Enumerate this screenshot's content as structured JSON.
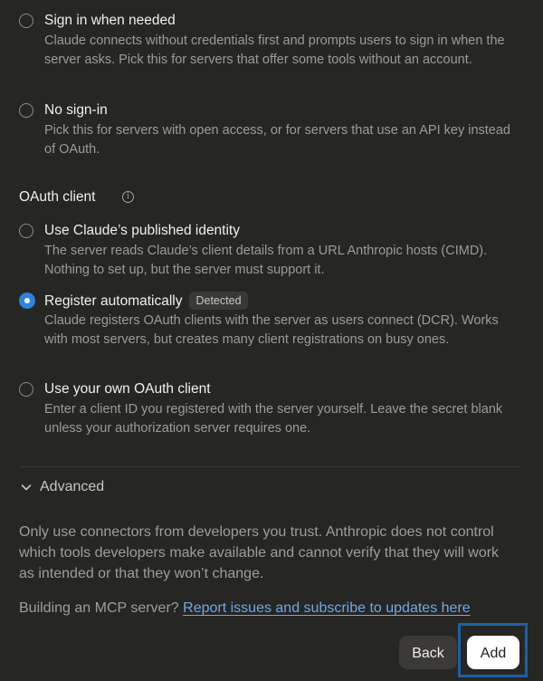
{
  "auth": {
    "options": [
      {
        "title": "Sign in when needed",
        "description": "Claude connects without credentials first and prompts users to sign in when the server asks. Pick this for servers that offer some tools without an account.",
        "selected": false
      },
      {
        "title": "No sign-in",
        "description": "Pick this for servers with open access, or for servers that use an API key instead of OAuth.",
        "selected": false
      }
    ]
  },
  "oauth_client": {
    "title": "OAuth client",
    "info_icon": "info-icon",
    "options": [
      {
        "title": "Use Claude’s published identity",
        "description": "The server reads Claude’s client details from a URL Anthropic hosts (CIMD). Nothing to set up, but the server must support it.",
        "selected": false
      },
      {
        "title": "Register automatically",
        "badge": "Detected",
        "description": "Claude registers OAuth clients with the server as users connect (DCR). Works with most servers, but creates many client registrations on busy ones.",
        "selected": true
      },
      {
        "title": "Use your own OAuth client",
        "description": "Enter a client ID you registered with the server yourself. Leave the secret blank unless your authorization server requires one.",
        "selected": false
      }
    ]
  },
  "advanced": {
    "label": "Advanced",
    "icon": "chevron-down-icon"
  },
  "notice": "Only use connectors from developers you trust. Anthropic does not control which tools developers make available and cannot verify that they will work as intended or that they won’t change.",
  "mcp": {
    "prefix": "Building an MCP server?",
    "link": "Report issues and subscribe to updates here"
  },
  "footer": {
    "back_label": "Back",
    "add_label": "Add"
  },
  "colors": {
    "background": "#262624",
    "accent": "#2c84db",
    "link": "#6fa8e6"
  }
}
